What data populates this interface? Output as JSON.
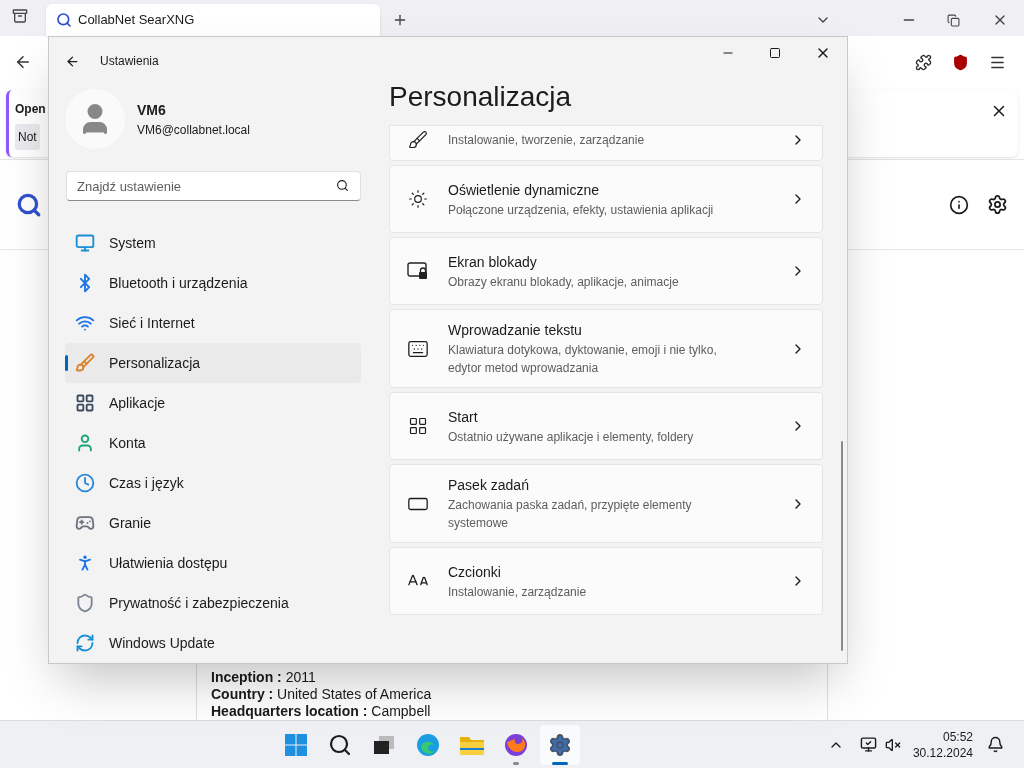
{
  "browser": {
    "tab": {
      "title": "CollabNet SearXNG"
    },
    "notification": {
      "text": "Open",
      "button": "Not"
    },
    "infobox": [
      {
        "label": "Inception :",
        "value": "2011"
      },
      {
        "label": "Country :",
        "value": "United States of America"
      },
      {
        "label": "Headquarters location :",
        "value": "Campbell"
      }
    ]
  },
  "settings": {
    "title": "Ustawienia",
    "user": {
      "name": "VM6",
      "email": "VM6@collabnet.local"
    },
    "search": {
      "placeholder": "Znajdź ustawienie"
    },
    "nav": [
      {
        "label": "System",
        "selected": false
      },
      {
        "label": "Bluetooth i urządzenia",
        "selected": false
      },
      {
        "label": "Sieć i Internet",
        "selected": false
      },
      {
        "label": "Personalizacja",
        "selected": true
      },
      {
        "label": "Aplikacje",
        "selected": false
      },
      {
        "label": "Konta",
        "selected": false
      },
      {
        "label": "Czas i język",
        "selected": false
      },
      {
        "label": "Granie",
        "selected": false
      },
      {
        "label": "Ułatwienia dostępu",
        "selected": false
      },
      {
        "label": "Prywatność i zabezpieczenia",
        "selected": false
      },
      {
        "label": "Windows Update",
        "selected": false
      }
    ],
    "heading": "Personalizacja",
    "cards": [
      {
        "subtitle": "Instalowanie, tworzenie, zarządzanie"
      },
      {
        "title": "Oświetlenie dynamiczne",
        "subtitle": "Połączone urządzenia, efekty, ustawienia aplikacji"
      },
      {
        "title": "Ekran blokady",
        "subtitle": "Obrazy ekranu blokady, aplikacje, animacje"
      },
      {
        "title": "Wprowadzanie tekstu",
        "subtitle": "Klawiatura dotykowa, dyktowanie, emoji i nie tylko, edytor metod wprowadzania"
      },
      {
        "title": "Start",
        "subtitle": "Ostatnio używane aplikacje i elementy, foldery"
      },
      {
        "title": "Pasek zadań",
        "subtitle": "Zachowania paska zadań, przypięte elementy systemowe"
      },
      {
        "title": "Czcionki",
        "subtitle": "Instalowanie, zarządzanie"
      }
    ]
  },
  "taskbar": {
    "apps": [
      {
        "running": false,
        "selected": false
      },
      {
        "running": false,
        "selected": false
      },
      {
        "running": false,
        "selected": false
      },
      {
        "running": false,
        "selected": false
      },
      {
        "running": false,
        "selected": false
      },
      {
        "running": true,
        "selected": false
      },
      {
        "running": true,
        "selected": true
      }
    ],
    "time": "05:52",
    "date": "30.12.2024"
  }
}
